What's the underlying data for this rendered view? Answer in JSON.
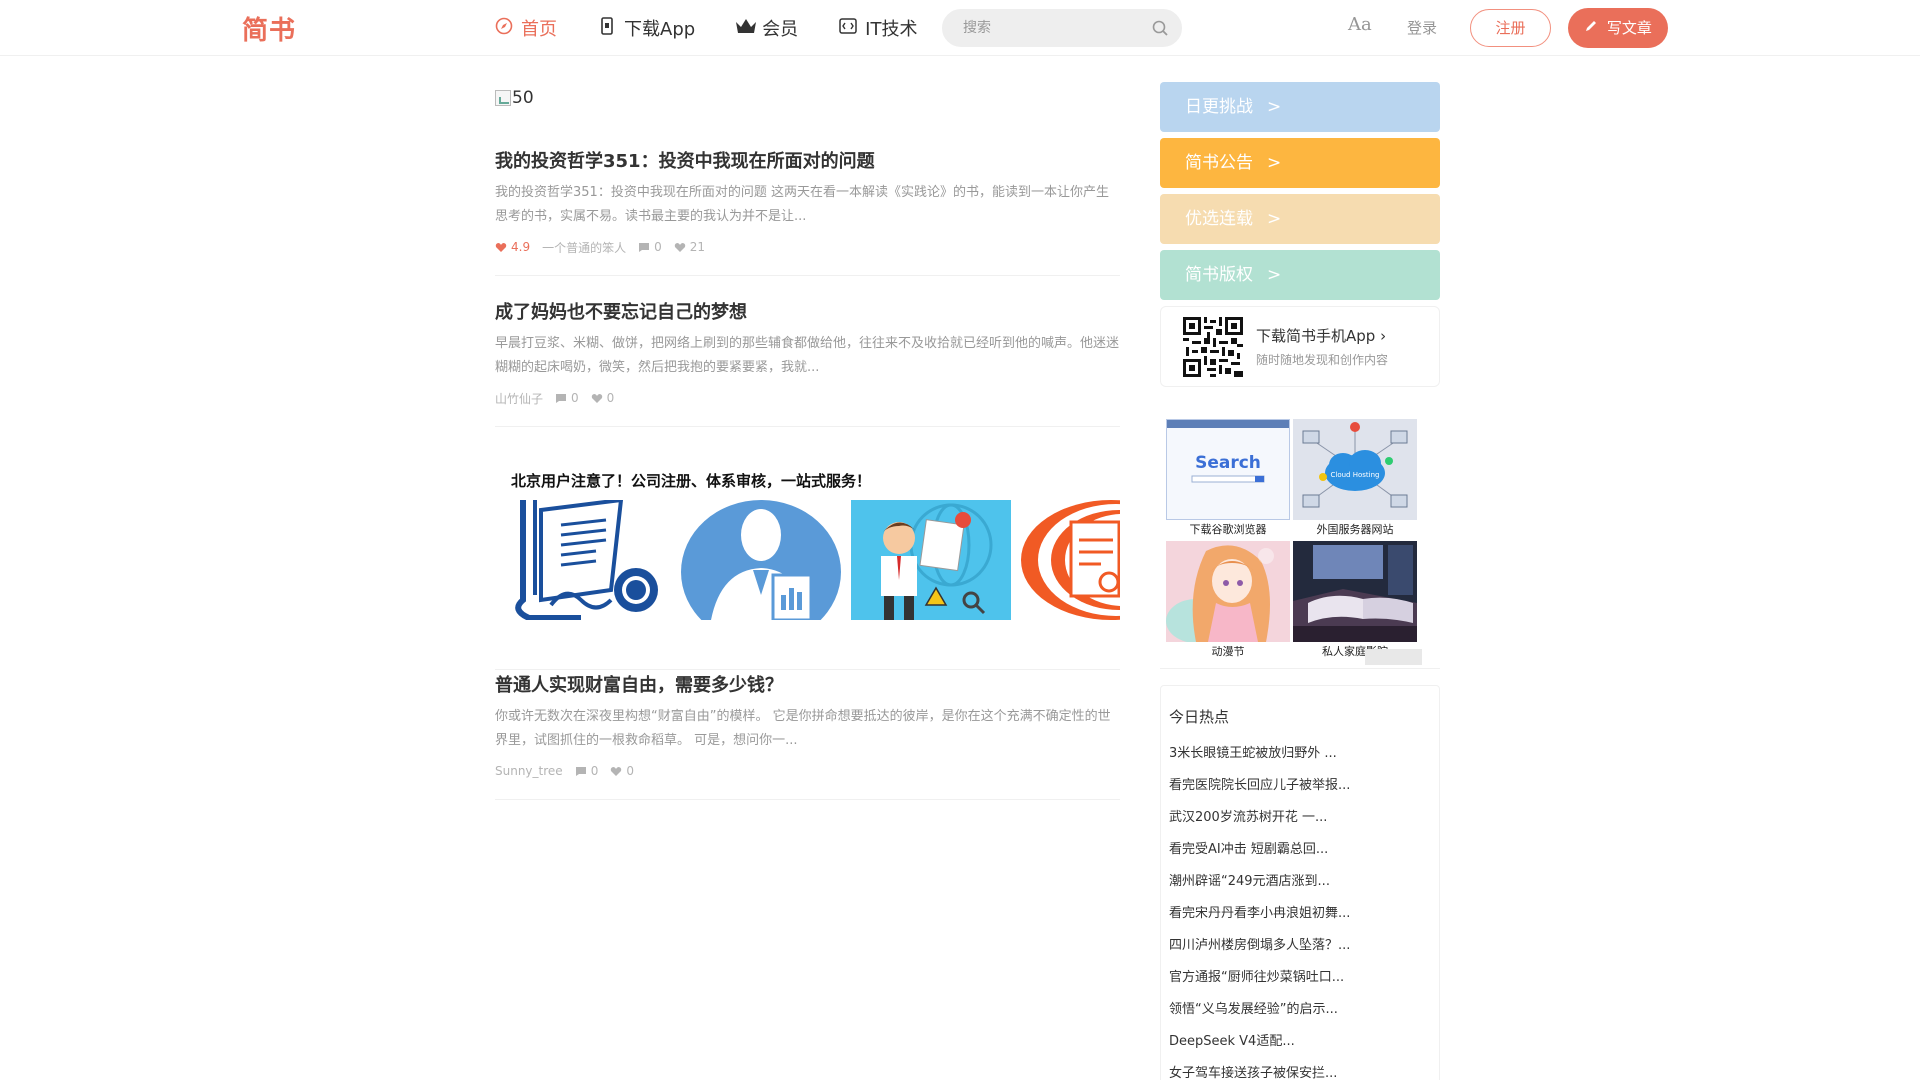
{
  "header": {
    "logo": "简书",
    "nav": [
      {
        "label": "首页",
        "icon": "compass-icon",
        "active": true
      },
      {
        "label": "下载App",
        "icon": "phone-icon",
        "active": false
      },
      {
        "label": "会员",
        "icon": "crown-icon",
        "active": false
      },
      {
        "label": "IT技术",
        "icon": "code-icon",
        "active": false
      }
    ],
    "search_placeholder": "搜索",
    "font_toggle": "Aa",
    "login": "登录",
    "signup": "注册",
    "write": "写文章"
  },
  "banner_alt": "50",
  "articles": [
    {
      "title": "我的投资哲学351：投资中我现在所面对的问题",
      "abstract": "我的投资哲学351：投资中我现在所面对的问题 这两天在看一本解读《实践论》的书，能读到一本让你产生思考的书，实属不易。读书最主要的我认为并不是让...",
      "score": "4.9",
      "author": "一个普通的笨人",
      "comments": "0",
      "likes": "21"
    },
    {
      "title": "成了妈妈也不要忘记自己的梦想",
      "abstract": "早晨打豆浆、米糊、做饼，把网络上刷到的那些辅食都做给他，往往来不及收拾就已经听到他的喊声。他迷迷糊糊的起床喝奶，微笑，然后把我抱的要紧要紧，我就...",
      "author": "山竹仙子",
      "comments": "0",
      "likes": "0"
    },
    {
      "title": "普通人实现财富自由，需要多少钱？",
      "abstract": "你或许无数次在深夜里构想“财富自由”的模样。 它是你拼命想要抵达的彼岸，是你在这个充满不确定性的世界里，试图抓住的一根救命稻草。 可是，想问你一...",
      "author": "Sunny_tree",
      "comments": "0",
      "likes": "0"
    }
  ],
  "ad": {
    "headline": "北京用户注意了！公司注册、体系审核，一站式服务！"
  },
  "sidebar": {
    "boards": [
      {
        "label": "日更挑战",
        "arrow": ">",
        "color": "#b9d5ef"
      },
      {
        "label": "简书公告",
        "arrow": ">",
        "color": "#fdb640"
      },
      {
        "label": "优选连载",
        "arrow": ">",
        "color": "#f6dcb0"
      },
      {
        "label": "简书版权",
        "arrow": ">",
        "color": "#b2e1d2"
      }
    ],
    "download": {
      "title": "下载简书手机App",
      "arrow": "›",
      "subtitle": "随时随地发现和创作内容"
    },
    "ads": [
      {
        "caption": "下载谷歌浏览器",
        "image_text": "Search"
      },
      {
        "caption": "外国服务器网站",
        "image_text": "Cloud Hosting"
      },
      {
        "caption": "动漫节",
        "image_text": ""
      },
      {
        "caption": "私人家庭影院",
        "image_text": ""
      }
    ],
    "hot": {
      "title": "今日热点",
      "items": [
        "3米长眼镜王蛇被放归野外 ...",
        "看完医院院长回应儿子被举报...",
        "武汉200岁流苏树开花 一...",
        "看完受AI冲击 短剧霸总回...",
        "潮州辟谣“249元酒店涨到...",
        "看完宋丹丹看李小冉浪姐初舞...",
        "四川泸州楼房倒塌多人坠落？...",
        "官方通报“厨师往炒菜锅吐口...",
        "领悟“义乌发展经验”的启示...",
        "DeepSeek V4适配...",
        "女子驾车接送孩子被保安拦..."
      ]
    }
  },
  "colors": {
    "accent": "#ea6f5a",
    "meta": "#b4b4b4"
  }
}
